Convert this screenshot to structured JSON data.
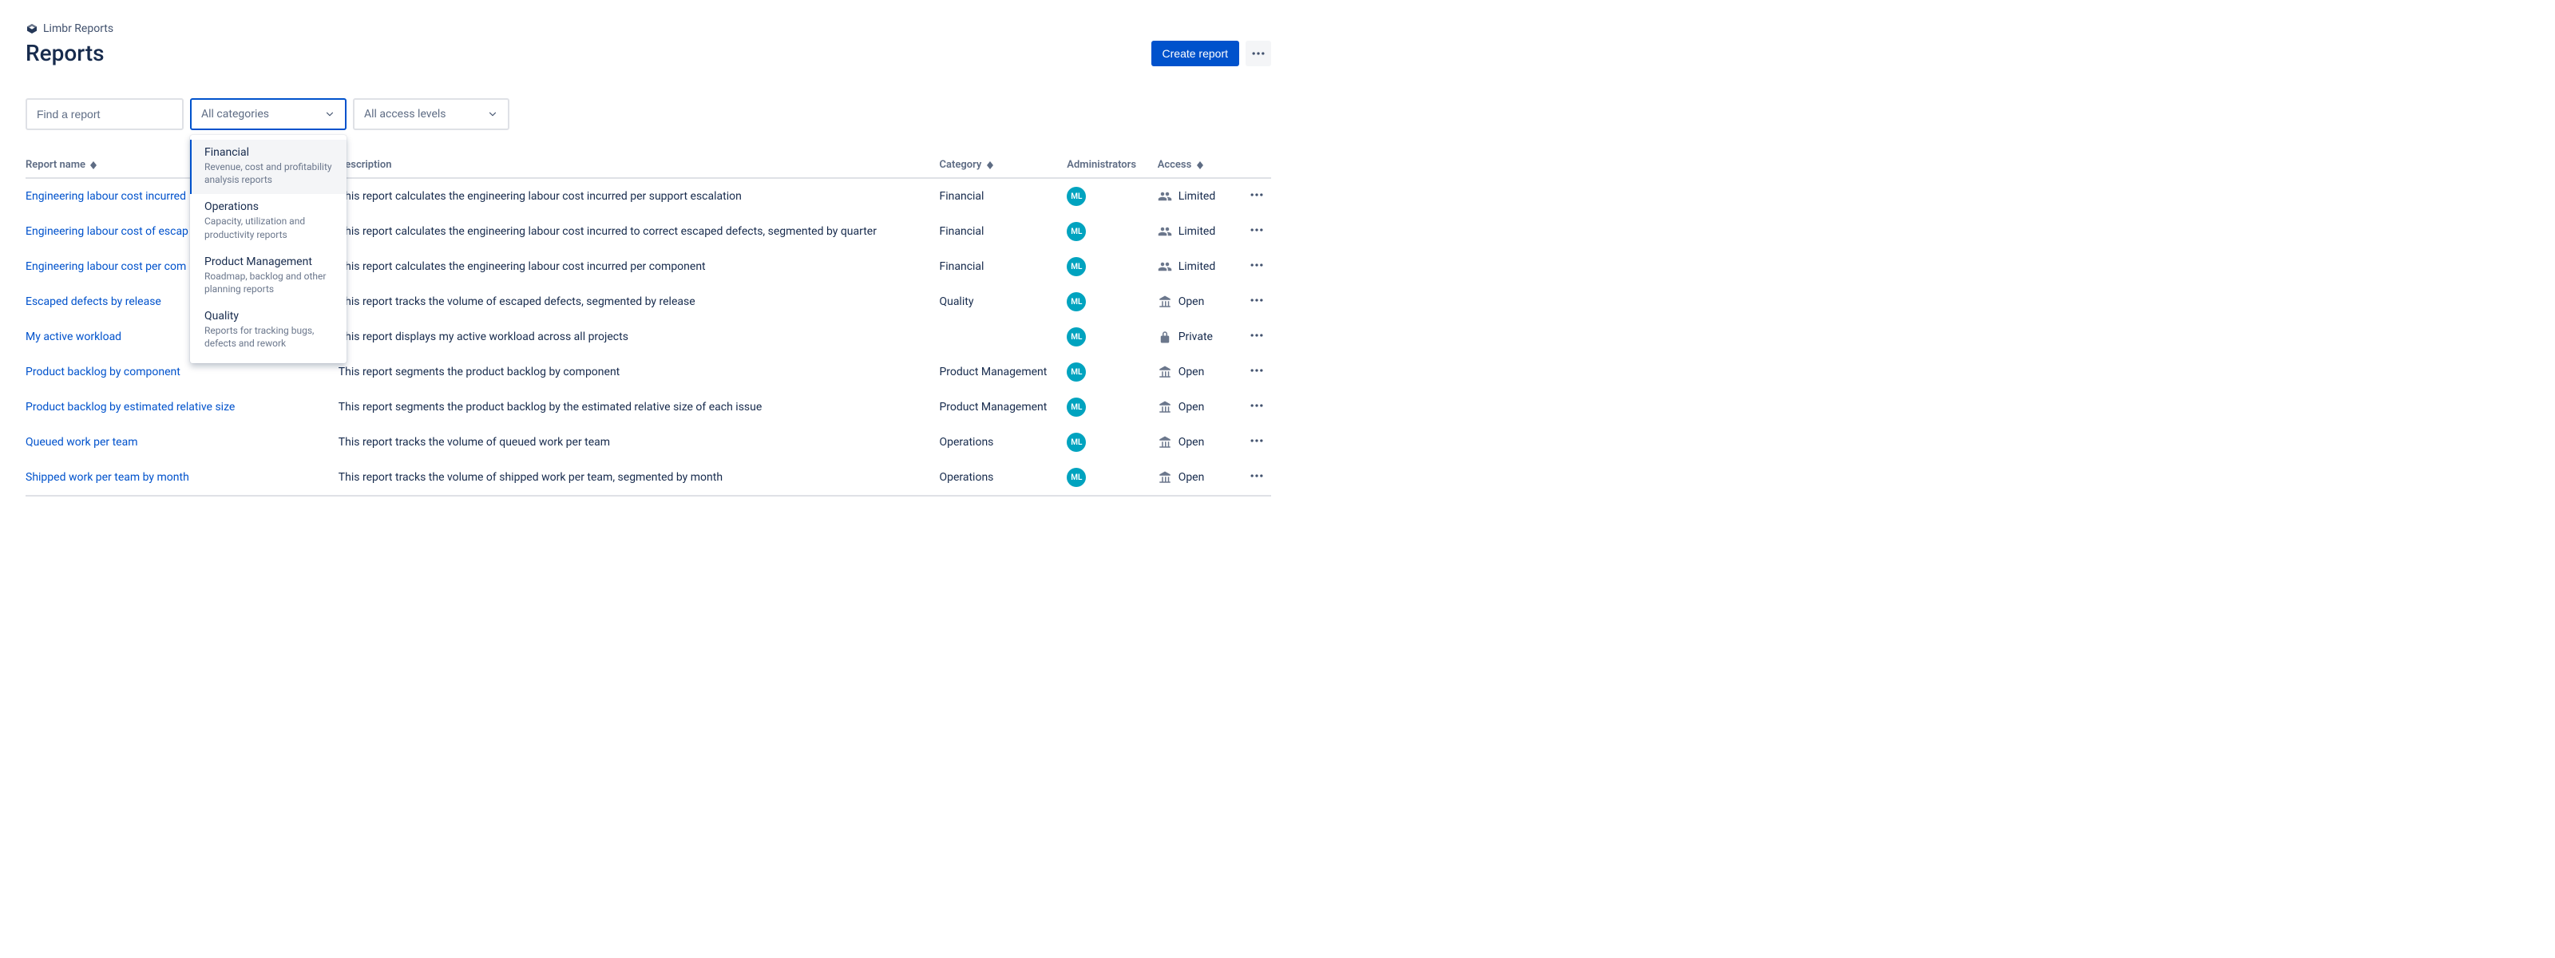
{
  "breadcrumb": {
    "app": "Limbr Reports"
  },
  "header": {
    "title": "Reports",
    "create_label": "Create report"
  },
  "filters": {
    "search_placeholder": "Find a report",
    "category_label": "All categories",
    "access_label": "All access levels"
  },
  "category_menu": [
    {
      "title": "Financial",
      "desc": "Revenue, cost and profitability analysis reports",
      "selected": true
    },
    {
      "title": "Operations",
      "desc": "Capacity, utilization and productivity reports",
      "selected": false
    },
    {
      "title": "Product Management",
      "desc": "Roadmap, backlog and other planning reports",
      "selected": false
    },
    {
      "title": "Quality",
      "desc": "Reports for tracking bugs, defects and rework",
      "selected": false
    }
  ],
  "columns": {
    "name": "Report name",
    "desc": "Description",
    "category": "Category",
    "admins": "Administrators",
    "access": "Access"
  },
  "admin_initials": "ML",
  "access_levels": {
    "limited": "Limited",
    "open": "Open",
    "private": "Private"
  },
  "rows": [
    {
      "name": "Engineering labour cost incurred",
      "desc": "This report calculates the engineering labour cost incurred per support escalation",
      "category": "Financial",
      "access": "limited"
    },
    {
      "name": "Engineering labour cost of escap",
      "desc": "This report calculates the engineering labour cost incurred to correct escaped defects, segmented by quarter",
      "category": "Financial",
      "access": "limited"
    },
    {
      "name": "Engineering labour cost per com",
      "desc": "This report calculates the engineering labour cost incurred per component",
      "category": "Financial",
      "access": "limited"
    },
    {
      "name": "Escaped defects by release",
      "desc": "This report tracks the volume of escaped defects, segmented by release",
      "category": "Quality",
      "access": "open"
    },
    {
      "name": "My active workload",
      "desc": "This report displays my active workload across all projects",
      "category": "",
      "access": "private"
    },
    {
      "name": "Product backlog by component",
      "desc": "This report segments the product backlog by component",
      "category": "Product Management",
      "access": "open"
    },
    {
      "name": "Product backlog by estimated relative size",
      "desc": "This report segments the product backlog by the estimated relative size of each issue",
      "category": "Product Management",
      "access": "open"
    },
    {
      "name": "Queued work per team",
      "desc": "This report tracks the volume of queued work per team",
      "category": "Operations",
      "access": "open"
    },
    {
      "name": "Shipped work per team by month",
      "desc": "This report tracks the volume of shipped work per team, segmented by month",
      "category": "Operations",
      "access": "open"
    }
  ]
}
